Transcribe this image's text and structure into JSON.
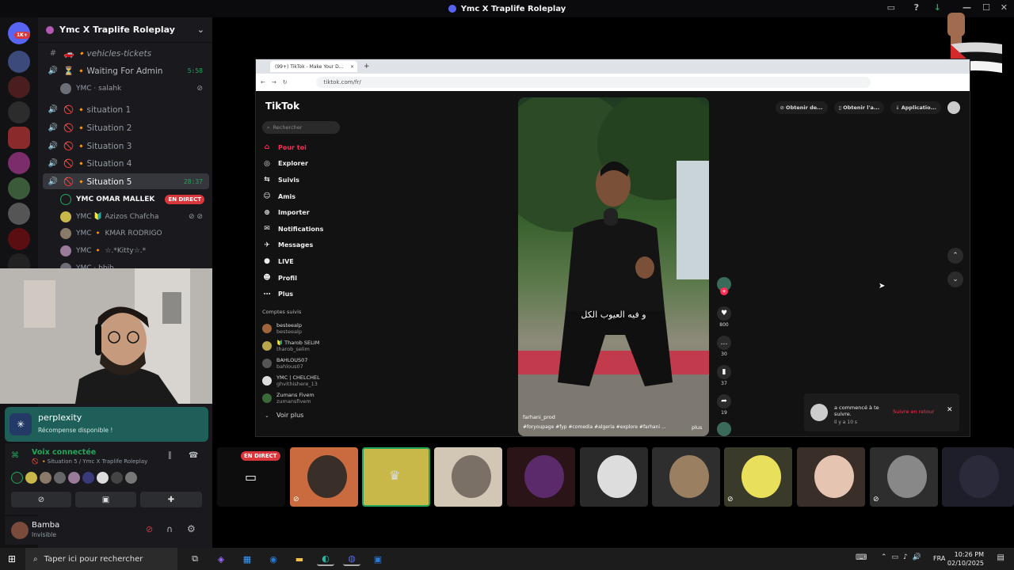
{
  "window": {
    "title": "Ymc X Traplife Roleplay"
  },
  "rail": {
    "notif_badge": "1K+"
  },
  "server": {
    "name": "Ymc X Traplife Roleplay"
  },
  "channels": [
    {
      "name": "🚗 🔸vehicles-tickets",
      "icon": "#",
      "type": "text"
    },
    {
      "name": "⏳ 🔸Waiting For Admin",
      "icon": "🔊",
      "time": "5:58"
    },
    {
      "name": "🚫 🔸situation 1",
      "icon": "🔊"
    },
    {
      "name": "🚫 🔸Situation 2",
      "icon": "🔊"
    },
    {
      "name": "🚫 🔸Situation 3",
      "icon": "🔊"
    },
    {
      "name": "🚫 🔸Situation 4",
      "icon": "🔊"
    },
    {
      "name": "🚫 🔸Situation 5",
      "icon": "🔊",
      "time": "28:37",
      "active": true
    }
  ],
  "waiting_user": "YMC · salahk",
  "voice_users": [
    {
      "name": "YMC  OMAR MALLEK",
      "live": "EN DIRECT"
    },
    {
      "name": "YMC 🔰 Azizos Chafcha"
    },
    {
      "name": "YMC 🔸 KMAR RODRIGO"
    },
    {
      "name": "YMC 🔸 ☆.*Kitty☆.*"
    },
    {
      "name": "YMC · bbib"
    }
  ],
  "perplexity": {
    "title": "perplexity",
    "subtitle": "Récompense disponible !"
  },
  "voice": {
    "status": "Voix connectée",
    "channel": "🚫 🔸Situation 5 / Ymc X Traplife Roleplay"
  },
  "user": {
    "name": "Bamba",
    "status": "Invisible"
  },
  "browser": {
    "tab_title": "(99+) TikTok - Make Your D...",
    "url": "tiktok.com/fr/"
  },
  "tiktok": {
    "logo": "TikTok",
    "search_placeholder": "Rechercher",
    "nav": [
      {
        "label": "Pour toi",
        "icon": "⌂",
        "selected": true
      },
      {
        "label": "Explorer",
        "icon": "◎"
      },
      {
        "label": "Suivis",
        "icon": "⇆"
      },
      {
        "label": "Amis",
        "icon": "☺"
      },
      {
        "label": "Importer",
        "icon": "⊕"
      },
      {
        "label": "Notifications",
        "icon": "✉"
      },
      {
        "label": "Messages",
        "icon": "✈"
      },
      {
        "label": "LIVE",
        "icon": "●"
      },
      {
        "label": "Profil",
        "icon": "☻"
      },
      {
        "label": "Plus",
        "icon": "⋯"
      }
    ],
    "following_title": "Comptes suivis",
    "following": [
      {
        "name": "besteealp",
        "handle": "besteealp"
      },
      {
        "name": "🔰 Tharob SELIM",
        "handle": "tharob_selim"
      },
      {
        "name": "BAHLOUS07",
        "handle": "bahlous07"
      },
      {
        "name": "YMC | CHELCHEL",
        "handle": "ghvithishere_13"
      },
      {
        "name": "Zumans Fivem",
        "handle": "zumansfivem"
      }
    ],
    "voir_plus": "Voir plus",
    "top_actions": [
      "Obtenir de...",
      "Obtenir l'a...",
      "Applicatio..."
    ],
    "video": {
      "caption": "و فيه العيوب الكل",
      "author": "farhani_prod",
      "hashtags": "#foryoupage #fyp #comedia #algeria #explore #farhani ...",
      "more": "plus"
    },
    "actions": {
      "likes": "800",
      "comments": "30",
      "saves": "37",
      "shares": "19"
    },
    "toast": {
      "text": "a commencé à te suivre.",
      "time": "Il y a 10 s",
      "button": "Suivre en retour"
    }
  },
  "tiles": {
    "live": "EN DIRECT"
  },
  "taskbar": {
    "search": "Taper ici pour rechercher",
    "lang": "FRA",
    "time": "10:26 PM",
    "date": "02/10/2025"
  },
  "colors": {
    "accent": "#fe2c55",
    "discord_green": "#23a55a",
    "live_red": "#da373c"
  }
}
